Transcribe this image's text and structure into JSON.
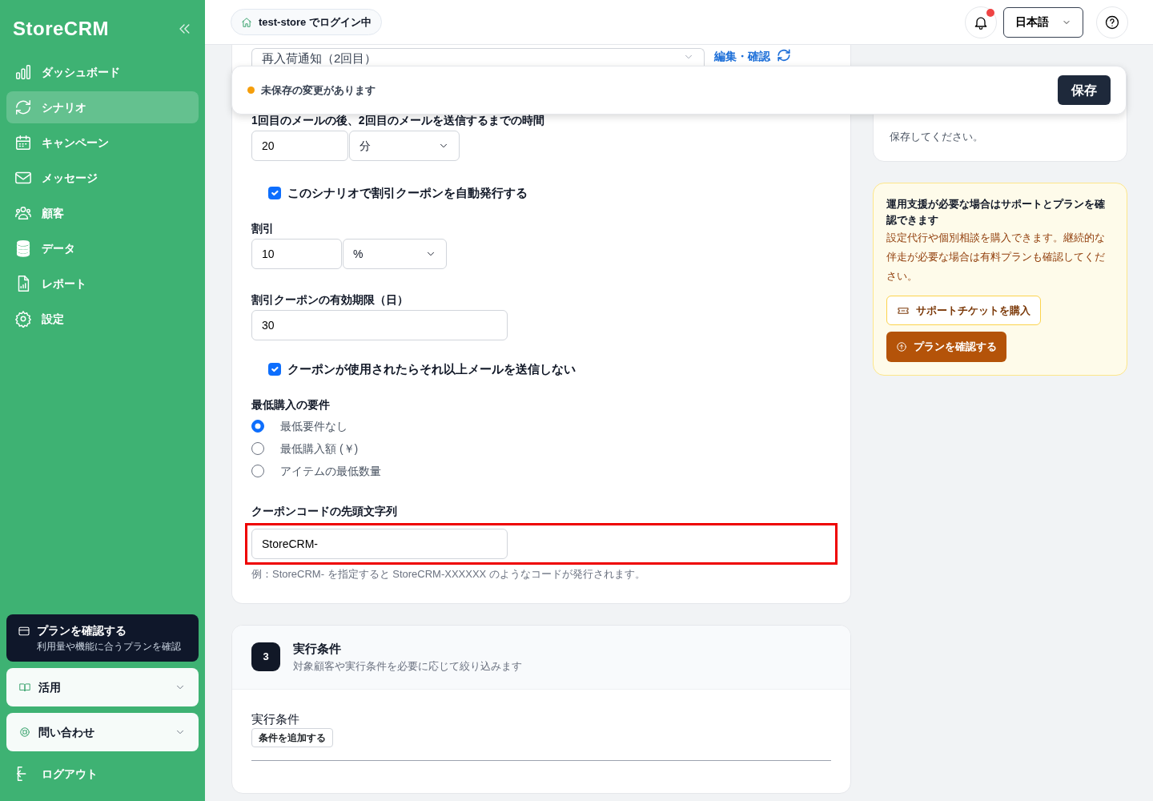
{
  "sidebar": {
    "logo": "StoreCRM",
    "items": [
      {
        "label": "ダッシュボード",
        "selected": false
      },
      {
        "label": "シナリオ",
        "selected": true
      },
      {
        "label": "キャンペーン",
        "selected": false
      },
      {
        "label": "メッセージ",
        "selected": false
      },
      {
        "label": "顧客",
        "selected": false
      },
      {
        "label": "データ",
        "selected": false
      },
      {
        "label": "レポート",
        "selected": false
      },
      {
        "label": "設定",
        "selected": false
      }
    ],
    "plan_card": {
      "title": "プランを確認する",
      "subtitle": "利用量や機能に合うプランを確認"
    },
    "sections": [
      {
        "label": "活用",
        "expanded": false
      },
      {
        "label": "問い合わせ",
        "expanded": false
      }
    ],
    "logout": "ログアウト"
  },
  "header": {
    "login_status": "test-store でログイン中",
    "notification_unread": true,
    "language": "日本語"
  },
  "save_bar": {
    "message": "未保存の変更があります",
    "button": "保存"
  },
  "scenario_card": {
    "template_select": "再入荷通知（2回目）",
    "edit_link": "編集・確認",
    "fields": [
      {
        "kind": "number_unit",
        "label": "1回目のメールの後、2回目のメールを送信するまでの時間",
        "value": "20",
        "unit": "分"
      },
      {
        "kind": "checkbox",
        "label": "このシナリオで割引クーポンを自動発行する",
        "checked": true
      },
      {
        "kind": "number_unit",
        "label": "割引",
        "value": "10",
        "unit": "%"
      },
      {
        "kind": "number",
        "label": "割引クーポンの有効期限（日）",
        "value": "30"
      },
      {
        "kind": "checkbox",
        "label": "クーポンが使用されたらそれ以上メールを送信しない",
        "checked": true
      },
      {
        "kind": "radio_group",
        "label": "最低購入の要件",
        "options": [
          {
            "label": "最低要件なし",
            "selected": true
          },
          {
            "label": "最低購入額 (￥)",
            "selected": false
          },
          {
            "label": "アイテムの最低数量",
            "selected": false
          }
        ]
      },
      {
        "kind": "text",
        "label": "クーポンコードの先頭文字列",
        "value": "StoreCRM-",
        "highlighted": true,
        "help": "例：StoreCRM- を指定すると StoreCRM-XXXXXX のようなコードが発行されます。"
      }
    ]
  },
  "conditions_card": {
    "step": "3",
    "title": "実行条件",
    "subtitle": "対象顧客や実行条件を必要に応じて絞り込みます",
    "conditions_label": "実行条件",
    "add_button": "条件を追加する"
  },
  "summary_card": {
    "text": "保存してください。"
  },
  "support_card": {
    "title": "運用支援が必要な場合はサポートとプランを確認できます",
    "text": "設定代行や個別相談を購入できます。継続的な伴走が必要な場合は有料プランも確認してください。",
    "buttons": [
      {
        "label": "サポートチケットを購入",
        "kind": "outline"
      },
      {
        "label": "プランを確認する",
        "kind": "primary"
      }
    ]
  }
}
